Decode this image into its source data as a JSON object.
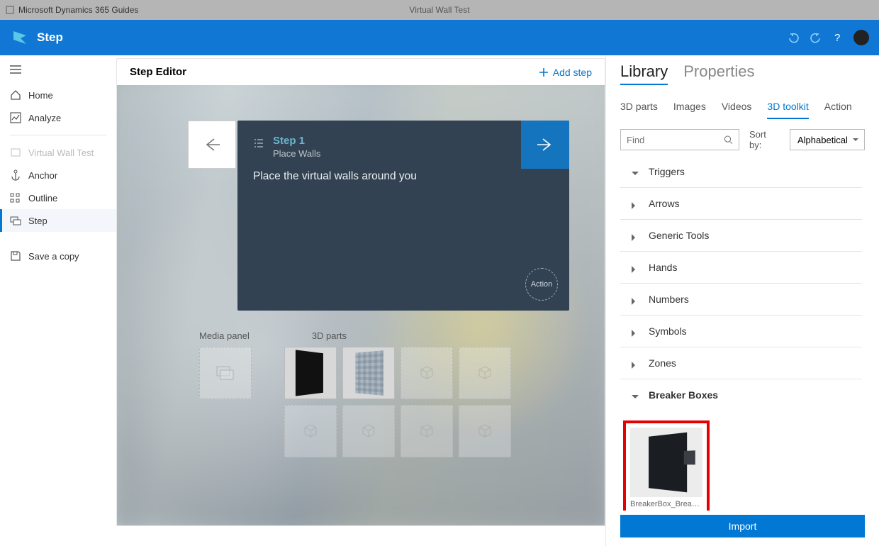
{
  "titlebar": {
    "appName": "Microsoft Dynamics 365 Guides",
    "document": "Virtual Wall Test"
  },
  "header": {
    "page": "Step"
  },
  "sidebar": {
    "items": [
      {
        "id": "home",
        "label": "Home"
      },
      {
        "id": "analyze",
        "label": "Analyze"
      },
      {
        "id": "guide",
        "label": "Virtual Wall Test"
      },
      {
        "id": "anchor",
        "label": "Anchor"
      },
      {
        "id": "outline",
        "label": "Outline"
      },
      {
        "id": "step",
        "label": "Step"
      },
      {
        "id": "save-copy",
        "label": "Save a copy"
      }
    ]
  },
  "editor": {
    "title": "Step Editor",
    "addStep": "Add step",
    "step": {
      "number": "Step 1",
      "subtitle": "Place Walls",
      "instruction": "Place the virtual walls around you",
      "actionLabel": "Action"
    },
    "mediaPanelLabel": "Media panel",
    "partsLabel": "3D parts"
  },
  "library": {
    "panelTabs": {
      "library": "Library",
      "properties": "Properties"
    },
    "subtabs": [
      "3D parts",
      "Images",
      "Videos",
      "3D toolkit",
      "Action"
    ],
    "activeSubtab": "3D toolkit",
    "search": {
      "placeholder": "Find"
    },
    "sortLabel": "Sort by:",
    "sortValue": "Alphabetical",
    "categories": [
      {
        "label": "Triggers",
        "expanded": true
      },
      {
        "label": "Arrows",
        "expanded": false
      },
      {
        "label": "Generic Tools",
        "expanded": false
      },
      {
        "label": "Hands",
        "expanded": false
      },
      {
        "label": "Numbers",
        "expanded": false
      },
      {
        "label": "Symbols",
        "expanded": false
      },
      {
        "label": "Zones",
        "expanded": false
      },
      {
        "label": "Breaker Boxes",
        "expanded": true
      }
    ],
    "asset": {
      "name": "BreakerBox_Breaker_..."
    },
    "importLabel": "Import"
  }
}
